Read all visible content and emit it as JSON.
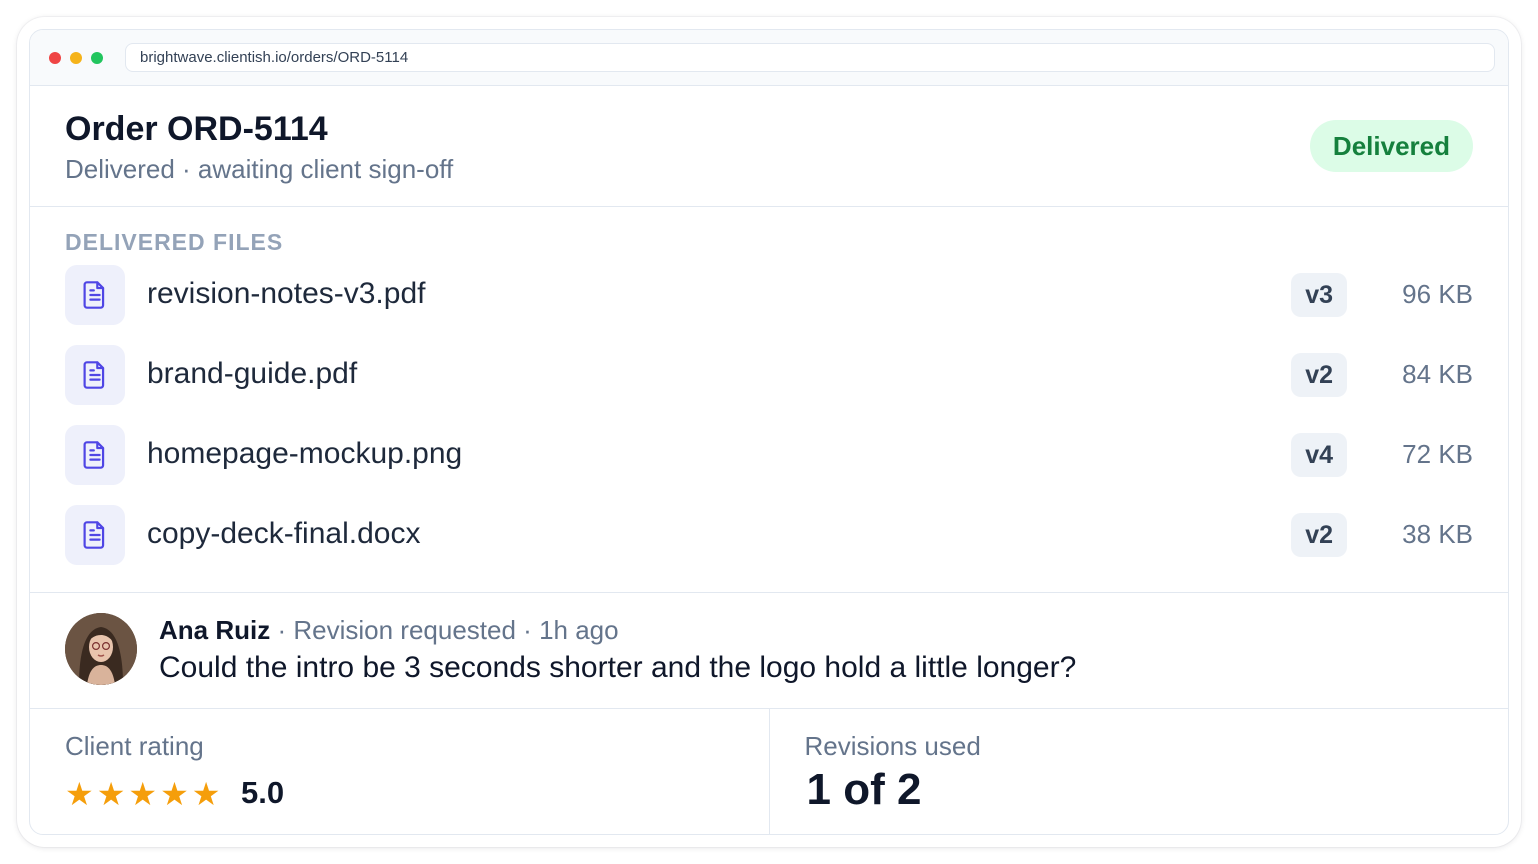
{
  "browser": {
    "url": "brightwave.clientish.io/orders/ORD-5114"
  },
  "order": {
    "title": "Order ORD-5114",
    "subtitle": "Delivered · awaiting client sign-off",
    "status": "Delivered",
    "status_color": "#15803d",
    "status_bg": "#dcfce7"
  },
  "files": {
    "section_label": "DELIVERED FILES",
    "items": [
      {
        "name": "revision-notes-v3.pdf",
        "version": "v3",
        "size": "96 KB",
        "icon": "document-icon"
      },
      {
        "name": "brand-guide.pdf",
        "version": "v2",
        "size": "84 KB",
        "icon": "document-icon"
      },
      {
        "name": "homepage-mockup.png",
        "version": "v4",
        "size": "72 KB",
        "icon": "document-icon"
      },
      {
        "name": "copy-deck-final.docx",
        "version": "v2",
        "size": "38 KB",
        "icon": "document-icon"
      }
    ]
  },
  "comment": {
    "author": "Ana Ruiz",
    "action": "Revision requested",
    "time": "1h ago",
    "text": "Could the intro be 3 seconds shorter and the logo hold a little longer?"
  },
  "stats": {
    "rating_label": "Client rating",
    "rating_value": "5.0",
    "stars": 5,
    "star_color": "#f59e0b",
    "revisions_label": "Revisions used",
    "revisions_value": "1 of 2"
  }
}
